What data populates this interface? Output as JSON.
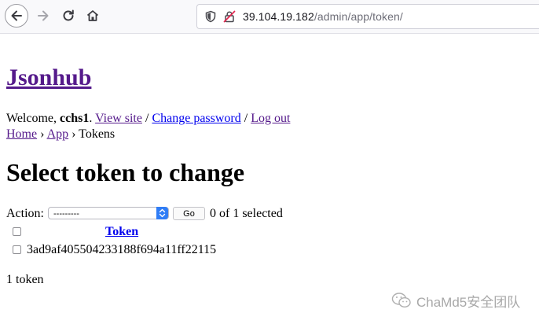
{
  "browser": {
    "url_host": "39.104.19.182",
    "url_path": "/admin/app/token/"
  },
  "site": {
    "title": "Jsonhub"
  },
  "user_tools": {
    "welcome": "Welcome,",
    "username": "cchs1",
    "period": ".",
    "view_site": "View site",
    "sep": "/",
    "change_password": "Change password",
    "log_out": "Log out"
  },
  "breadcrumbs": {
    "home": "Home",
    "arrow": "›",
    "app": "App",
    "current": "Tokens"
  },
  "page": {
    "title": "Select token to change"
  },
  "actions": {
    "label": "Action:",
    "select_value": "---------",
    "go_label": "Go",
    "selected_text": "0 of 1 selected"
  },
  "table": {
    "column_header": "Token",
    "rows": [
      {
        "token": "3ad9af405504233188f694a11ff22115"
      }
    ]
  },
  "paginator": {
    "text": "1 token"
  },
  "watermark": {
    "text": "ChaMd5安全团队"
  }
}
